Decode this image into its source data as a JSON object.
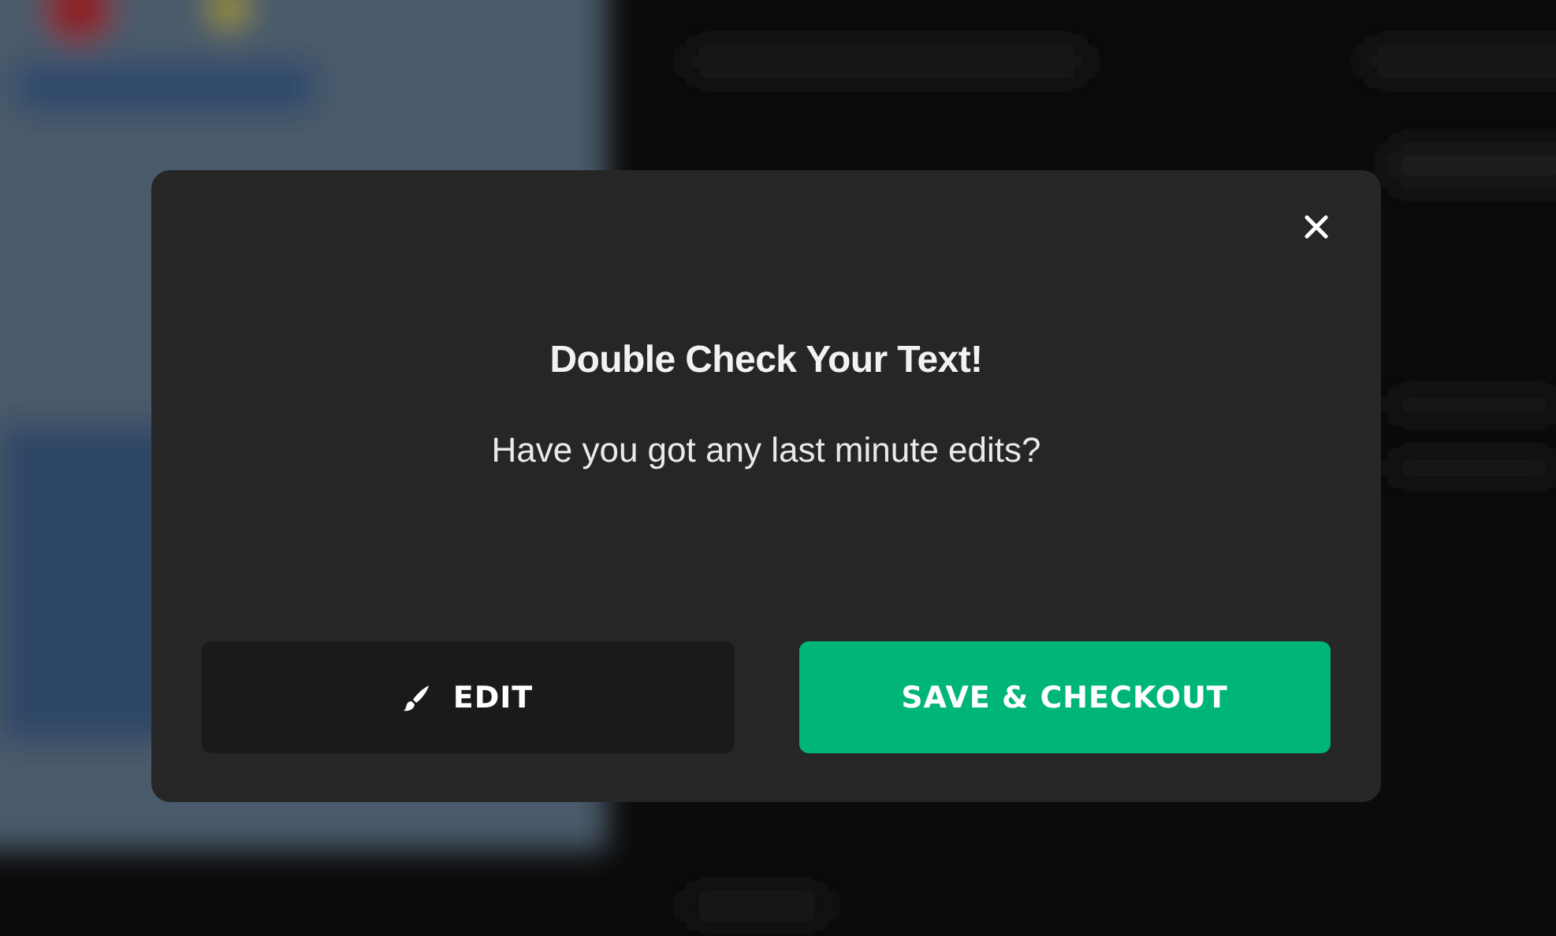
{
  "dialog": {
    "title": "Double Check Your Text!",
    "message": "Have you got any last minute edits?",
    "buttons": [
      {
        "label": "EDIT",
        "kind": "secondary"
      },
      {
        "label": "SAVE & CHECKOUT",
        "kind": "primary"
      }
    ]
  }
}
